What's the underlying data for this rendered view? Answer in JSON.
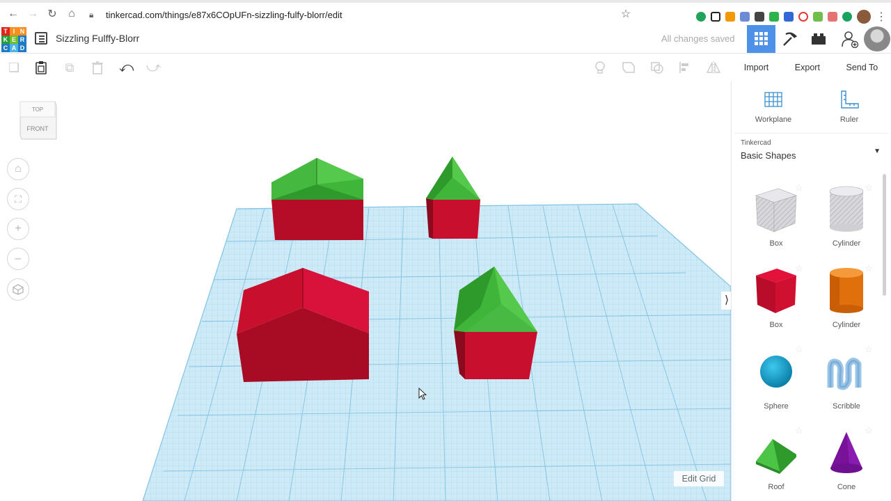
{
  "browser": {
    "url": "tinkercad.com/things/e87x6COpUFn-sizzling-fulfy-blorr/edit"
  },
  "app": {
    "logo_letters": [
      "T",
      "I",
      "N",
      "K",
      "E",
      "R",
      "C",
      "A",
      "D"
    ],
    "title": "Sizzling Fulffy-Blorr",
    "save_status": "All changes saved",
    "actions": {
      "import": "Import",
      "export": "Export",
      "send_to": "Send To"
    }
  },
  "workspace": {
    "viewcube": {
      "top": "TOP",
      "front": "FRONT"
    },
    "edit_grid": "Edit Grid",
    "colors": {
      "red": "#c8102e",
      "green": "#3fb53a",
      "grid": "#a9dcef"
    }
  },
  "panel": {
    "tools": [
      {
        "label": "Workplane",
        "icon": "workplane-icon"
      },
      {
        "label": "Ruler",
        "icon": "ruler-icon"
      }
    ],
    "category_source": "Tinkercad",
    "category": "Basic Shapes",
    "shapes": [
      {
        "label": "Box",
        "icon": "box-hole-icon"
      },
      {
        "label": "Cylinder",
        "icon": "cylinder-hole-icon"
      },
      {
        "label": "Box",
        "icon": "box-icon"
      },
      {
        "label": "Cylinder",
        "icon": "cylinder-icon"
      },
      {
        "label": "Sphere",
        "icon": "sphere-icon"
      },
      {
        "label": "Scribble",
        "icon": "scribble-icon"
      },
      {
        "label": "Roof",
        "icon": "roof-icon"
      },
      {
        "label": "Cone",
        "icon": "cone-icon"
      }
    ]
  }
}
